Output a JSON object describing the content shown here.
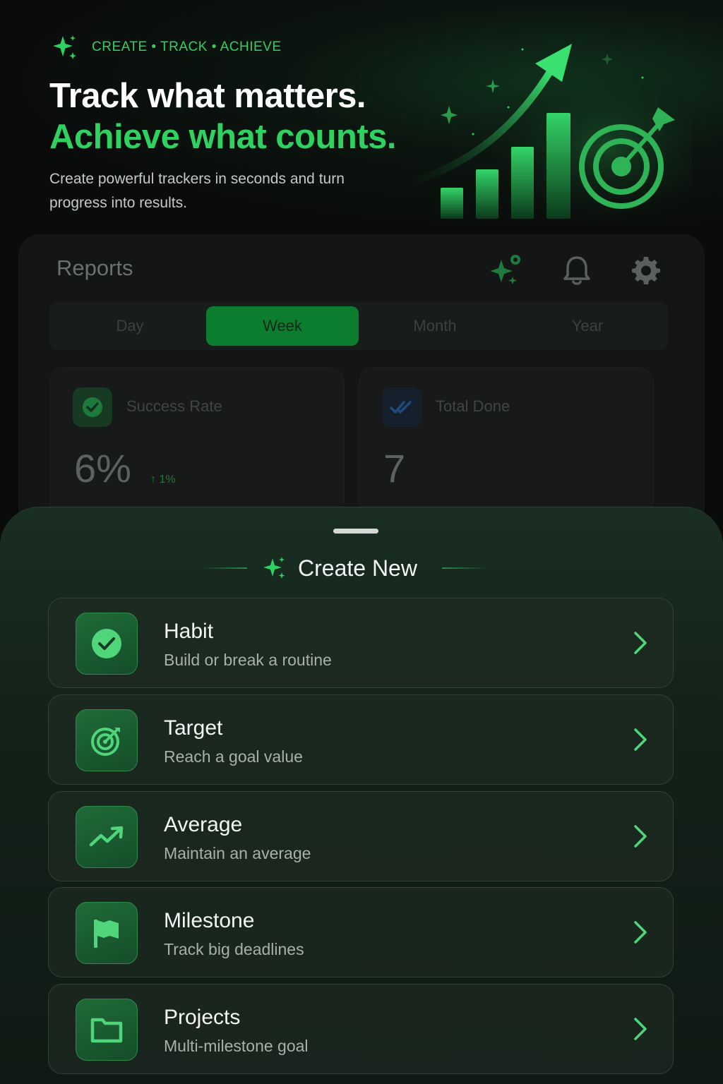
{
  "hero": {
    "tagline": "CREATE • TRACK • ACHIEVE",
    "headline_line1": "Track what matters.",
    "headline_line2": "Achieve what counts.",
    "subtitle": "Create powerful trackers in seconds and turn progress into results."
  },
  "reports": {
    "title": "Reports",
    "tabs": [
      "Day",
      "Week",
      "Month",
      "Year"
    ],
    "active_tab": "Week",
    "stats": [
      {
        "label": "Success Rate",
        "value": "6%",
        "delta": "↑ 1%",
        "icon": "check-icon"
      },
      {
        "label": "Total Done",
        "value": "7",
        "icon": "double-check-icon"
      }
    ]
  },
  "sheet": {
    "title": "Create New",
    "options": [
      {
        "title": "Habit",
        "subtitle": "Build or break a routine",
        "icon": "check-circle-icon"
      },
      {
        "title": "Target",
        "subtitle": "Reach a goal value",
        "icon": "target-icon"
      },
      {
        "title": "Average",
        "subtitle": "Maintain an average",
        "icon": "trend-up-icon"
      },
      {
        "title": "Milestone",
        "subtitle": "Track big deadlines",
        "icon": "flag-icon"
      },
      {
        "title": "Projects",
        "subtitle": "Multi-milestone goal",
        "icon": "folder-icon"
      }
    ]
  },
  "colors": {
    "accent": "#2fd160",
    "background": "#0a0c0b",
    "sheet": "#132119",
    "active_tab": "#0c7d2e"
  }
}
